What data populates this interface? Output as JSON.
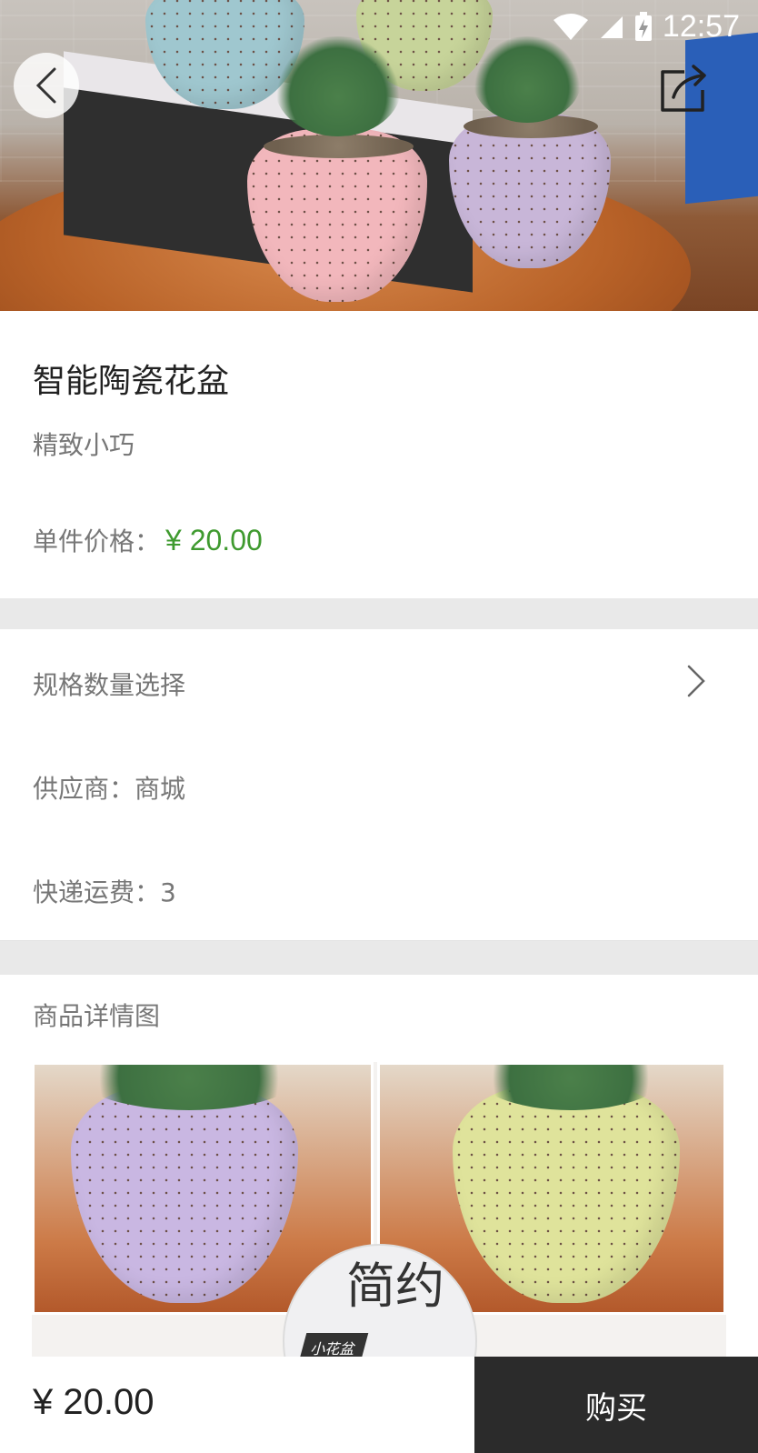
{
  "status_bar": {
    "time": "12:57",
    "icons": [
      "wifi-icon",
      "signal-icon",
      "battery-icon"
    ]
  },
  "header": {
    "back_icon": "back-arrow-icon",
    "share_icon": "share-icon"
  },
  "product": {
    "title": "智能陶瓷花盆",
    "subtitle": "精致小巧",
    "price_label": "单件价格：",
    "price_value": "¥ 20.00"
  },
  "rows": {
    "spec": "规格数量选择",
    "supplier": "供应商：商城",
    "shipping": "快递运费：3"
  },
  "detail": {
    "label": "商品详情图",
    "badge_big": "简约",
    "badge_small": "小花盆"
  },
  "bottom_bar": {
    "price": "¥ 20.00",
    "buy_label": "购买"
  },
  "colors": {
    "price_green": "#3f9a2f",
    "buy_bg": "#2b2b2b"
  }
}
